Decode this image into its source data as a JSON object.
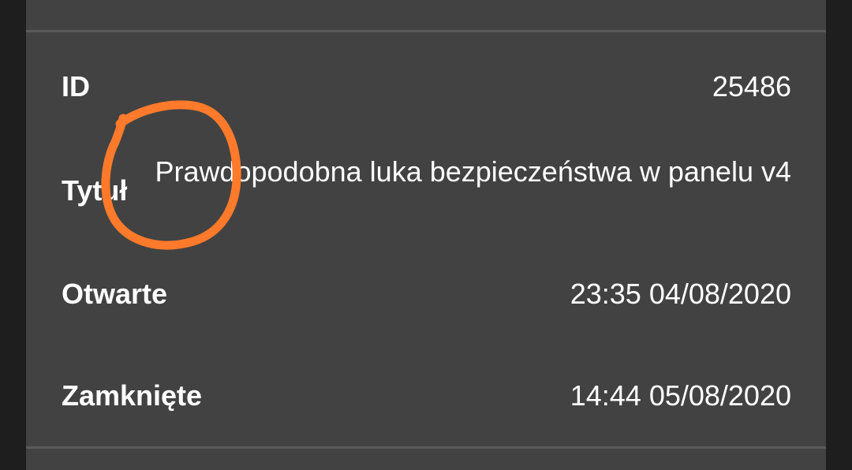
{
  "details": {
    "id": {
      "label": "ID",
      "value": "25486"
    },
    "title": {
      "label": "Tytuł",
      "value": "Prawdopodobna luka bezpieczeństwa w panelu v4"
    },
    "opened": {
      "label": "Otwarte",
      "value": "23:35 04/08/2020"
    },
    "closed": {
      "label": "Zamknięte",
      "value": "14:44 05/08/2020"
    }
  },
  "annotation": {
    "color": "#ff7a2a",
    "shape": "hand-drawn-circle"
  }
}
